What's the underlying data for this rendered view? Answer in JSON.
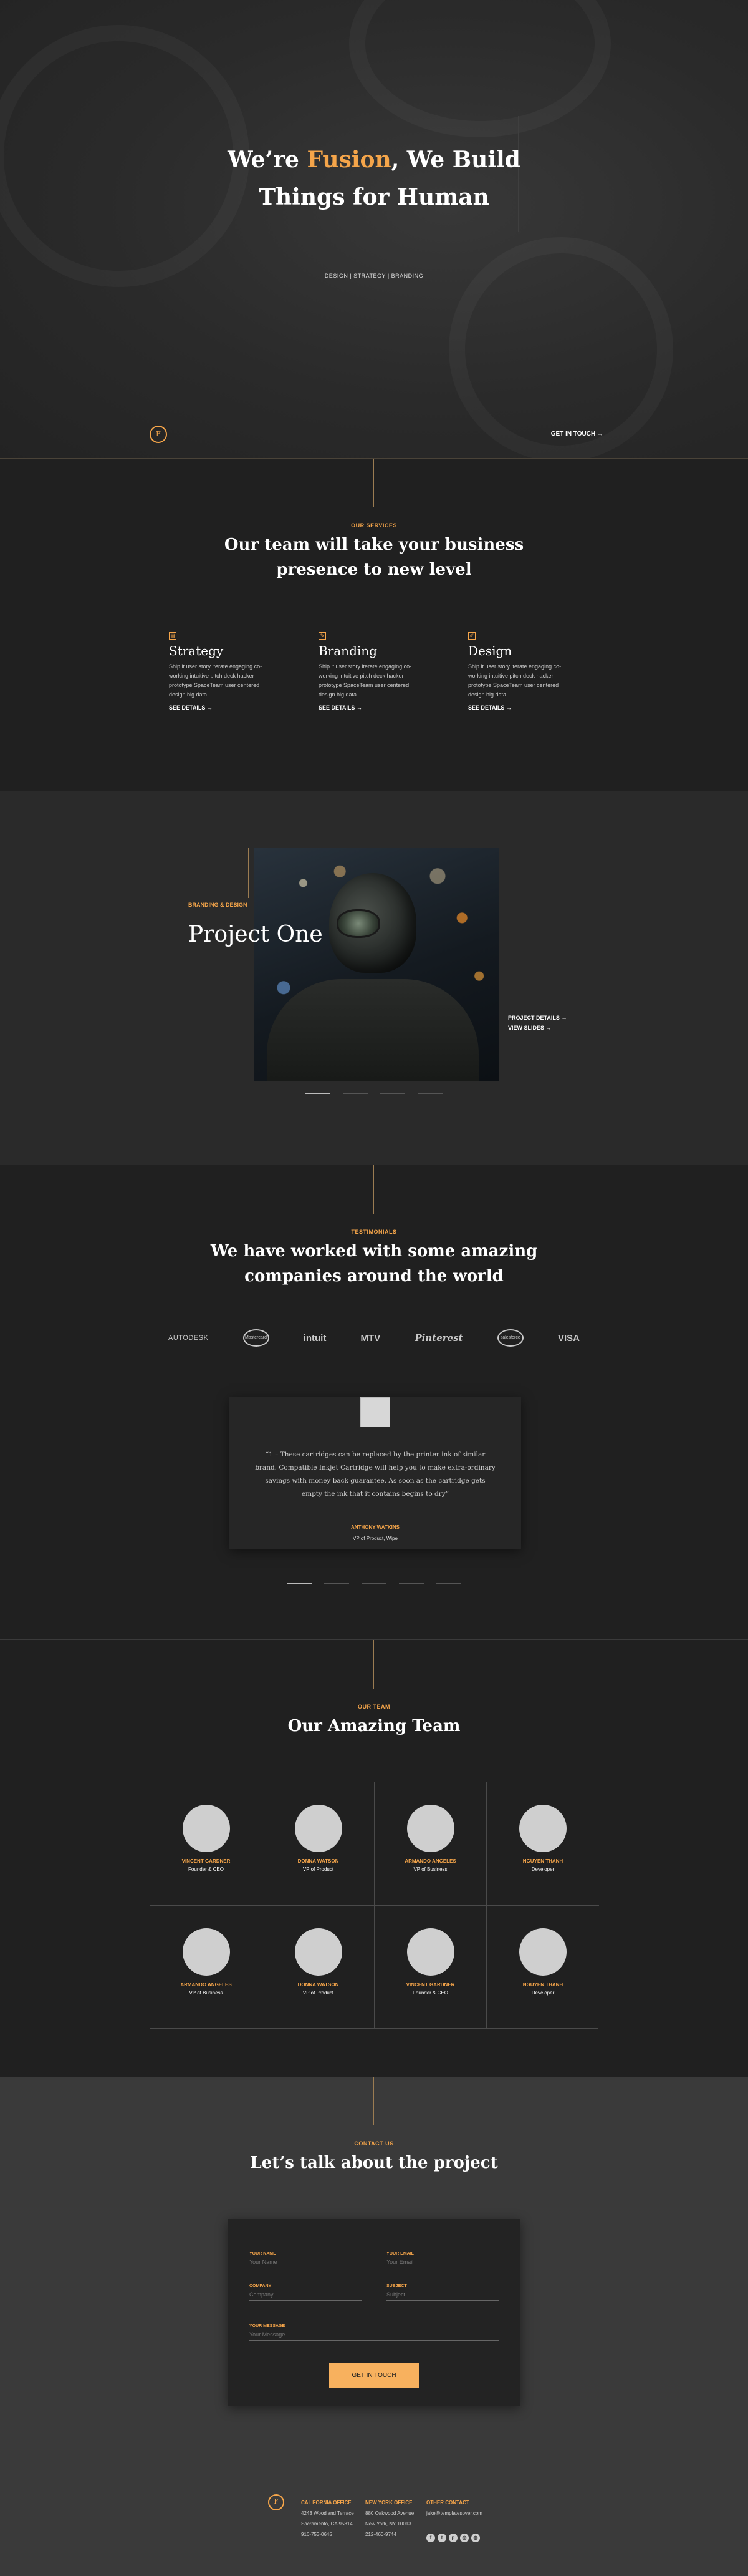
{
  "hero": {
    "title_pre": "We’re ",
    "title_accent": "Fusion",
    "title_post": ", We Build",
    "title_line2": "Things for Human",
    "tags": "DESIGN | STRATEGY | BRANDING",
    "logo_letter": "F",
    "cta": "GET IN TOUCH →"
  },
  "services": {
    "eyebrow": "OUR SERVICES",
    "title": "Our team will take your business presence to new level",
    "items": [
      {
        "title": "Strategy",
        "icon": "strategy-icon",
        "text": "Ship it user story iterate engaging co-working intuitive pitch deck hacker prototype SpaceTeam user centered design big data.",
        "link": "SEE DETAILS →"
      },
      {
        "title": "Branding",
        "icon": "branding-icon",
        "text": "Ship it user story iterate engaging co-working intuitive pitch deck hacker prototype SpaceTeam user centered design big data.",
        "link": "SEE DETAILS →"
      },
      {
        "title": "Design",
        "icon": "design-icon",
        "text": "Ship it user story iterate engaging co-working intuitive pitch deck hacker prototype SpaceTeam user centered design big data.",
        "link": "SEE DETAILS →"
      }
    ]
  },
  "project": {
    "category": "BRANDING & DESIGN",
    "title": "Project One",
    "details_link": "PROJECT DETAILS →",
    "slides_link": "VIEW SLIDES →"
  },
  "testimonials": {
    "eyebrow": "TESTIMONIALS",
    "title": "We have worked with some amazing companies around the world",
    "logos": [
      "AUTODESK",
      "Mastercard",
      "intuit",
      "MTV",
      "Pinterest",
      "salesforce",
      "VISA"
    ],
    "quote": "“1 – These cartridges can be replaced by the printer ink of similar brand. Compatible Inkjet Cartridge will help you to make extra-ordinary savings with money back guarantee. As soon as the cartridge gets empty the ink that it contains begins to dry”",
    "name": "ANTHONY WATKINS",
    "role": "VP of Product, Wipe"
  },
  "team": {
    "eyebrow": "OUR TEAM",
    "title": "Our Amazing Team",
    "members": [
      {
        "name": "VINCENT GARDNER",
        "role": "Founder & CEO"
      },
      {
        "name": "DONNA WATSON",
        "role": "VP of Product"
      },
      {
        "name": "ARMANDO ANGELES",
        "role": "VP of Business"
      },
      {
        "name": "NGUYEN THANH",
        "role": "Developer"
      },
      {
        "name": "ARMANDO ANGELES",
        "role": "VP of Business"
      },
      {
        "name": "DONNA WATSON",
        "role": "VP of Product"
      },
      {
        "name": "VINCENT GARDNER",
        "role": "Founder & CEO"
      },
      {
        "name": "NGUYEN THANH",
        "role": "Developer"
      }
    ]
  },
  "contact": {
    "eyebrow": "CONTACT US",
    "title": "Let’s talk about the project",
    "fields": {
      "name_label": "YOUR NAME",
      "name_placeholder": "Your Name",
      "email_label": "YOUR EMAIL",
      "email_placeholder": "Your Email",
      "company_label": "COMPANY",
      "company_placeholder": "Company",
      "subject_label": "SUBJECT",
      "subject_placeholder": "Subject",
      "message_label": "YOUR MESSAGE",
      "message_placeholder": "Your Message"
    },
    "submit": "GET IN TOUCH"
  },
  "footer": {
    "logo_letter": "F",
    "california": {
      "head": "CALIFORNIA OFFICE",
      "line1": "4243 Woodland Terrace",
      "line2": "Sacramento, CA 95814",
      "line3": "916-753-0645"
    },
    "newyork": {
      "head": "NEW YORK OFFICE",
      "line1": "880 Oakwood Avenue",
      "line2": "New York, NY 10013",
      "line3": "212-460-9744"
    },
    "other": {
      "head": "OTHER CONTACT",
      "line1": "jake@templatesover.com"
    },
    "socials": [
      "facebook-icon",
      "twitter-icon",
      "pinterest-icon",
      "instagram-icon",
      "dribbble-icon"
    ]
  },
  "colors": {
    "accent": "#f5a54a",
    "button": "#f8b15e",
    "dark": "#202020",
    "contact_bg": "#3a3a3a"
  }
}
